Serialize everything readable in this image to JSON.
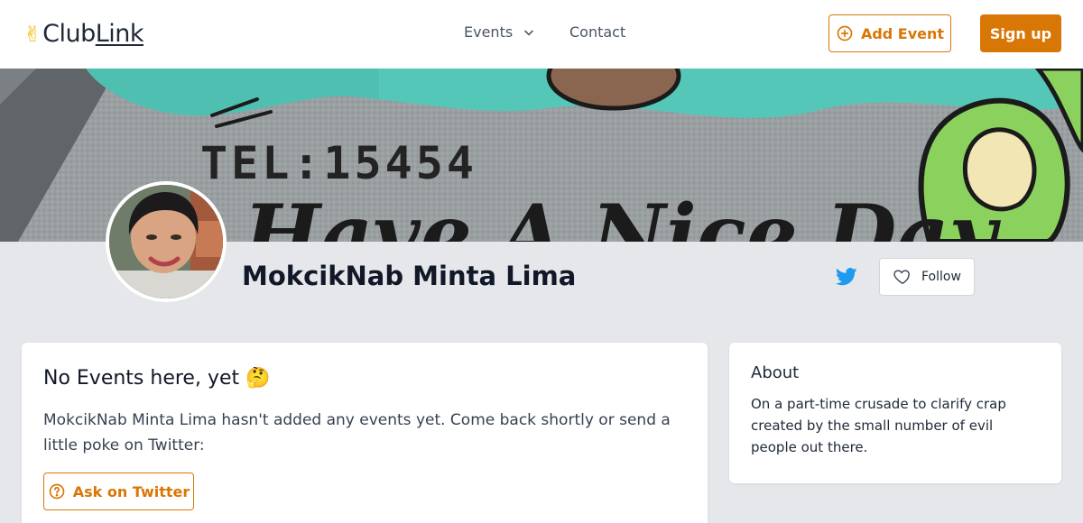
{
  "header": {
    "logo_icon": "victory-hand-icon",
    "logo_text_club": "Club",
    "logo_text_link": "Link",
    "nav": {
      "events_label": "Events",
      "contact_label": "Contact"
    },
    "add_event_label": "Add Event",
    "signup_label": "Sign up"
  },
  "banner": {
    "sign_text": "TEL:15454",
    "script_text": "Have A Nice Day"
  },
  "profile": {
    "name": "MokcikNab Minta Lima",
    "follow_label": "Follow",
    "social_icon": "twitter-icon"
  },
  "events_card": {
    "title": "No Events here, yet 🤔",
    "message": "MokcikNab Minta Lima hasn't added any events yet. Come back shortly or send a little poke on Twitter:",
    "ask_label": "Ask on Twitter"
  },
  "about_card": {
    "title": "About",
    "text": "On a part-time crusade to clarify crap created by the small number of evil people out there."
  },
  "colors": {
    "accent": "#d97706",
    "background": "#e5e7eb",
    "twitter": "#1d9bf0"
  }
}
